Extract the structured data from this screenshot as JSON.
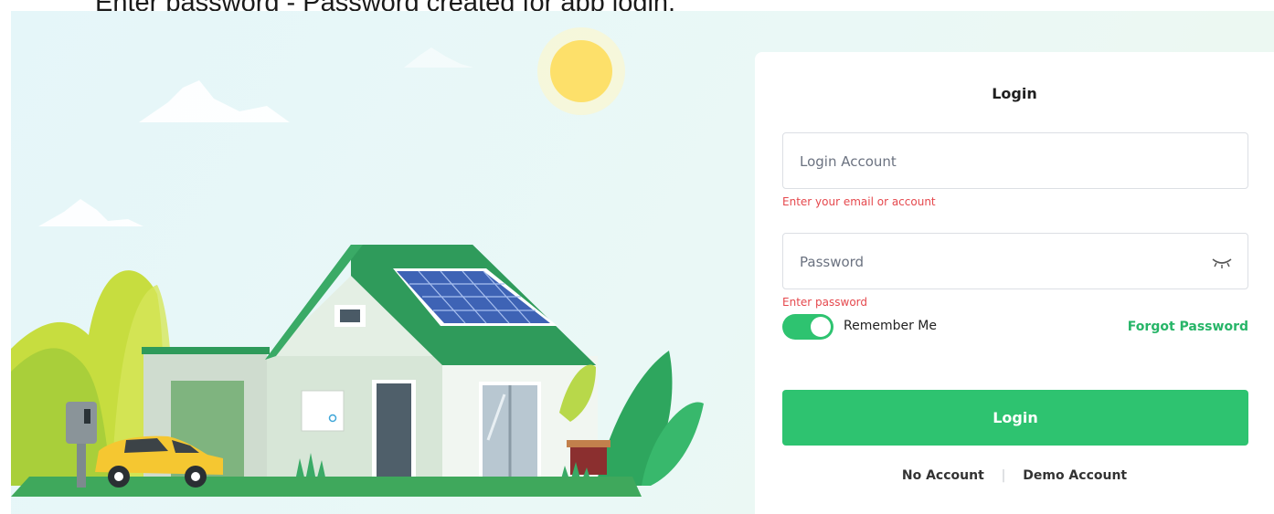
{
  "caption": "Enter password - Password created for app login.",
  "login": {
    "title": "Login",
    "account_placeholder": "Login Account",
    "account_error": "Enter your email or account",
    "password_placeholder": "Password",
    "password_error": "Enter password",
    "remember_label": "Remember Me",
    "remember_on": true,
    "forgot_label": "Forgot Password",
    "submit_label": "Login",
    "no_account_label": "No Account",
    "separator": "|",
    "demo_account_label": "Demo Account"
  },
  "icons": {
    "password_toggle": "eye-closed-icon"
  },
  "colors": {
    "accent": "#2ec370",
    "error": "#e5484d",
    "roof": "#2e9a5a",
    "car": "#f5c731",
    "sun": "#fde06a"
  }
}
